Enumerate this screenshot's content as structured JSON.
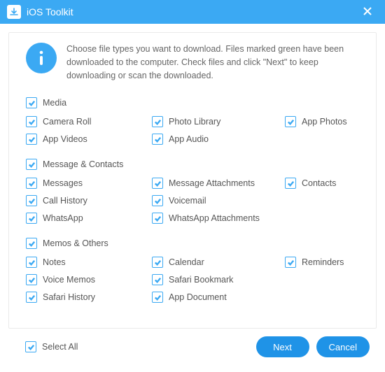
{
  "app": {
    "title": "iOS Toolkit"
  },
  "info": {
    "text": "Choose file types you want to download. Files marked green have been downloaded to the computer. Check files and click \"Next\" to keep downloading or scan the downloaded."
  },
  "groups": [
    {
      "header": "Media",
      "items": [
        {
          "label": "Camera Roll",
          "checked": true
        },
        {
          "label": "Photo Library",
          "checked": true
        },
        {
          "label": "App Photos",
          "checked": true
        },
        {
          "label": "App Videos",
          "checked": true
        },
        {
          "label": "App Audio",
          "checked": true
        }
      ]
    },
    {
      "header": "Message & Contacts",
      "items": [
        {
          "label": "Messages",
          "checked": true
        },
        {
          "label": "Message Attachments",
          "checked": true
        },
        {
          "label": "Contacts",
          "checked": true
        },
        {
          "label": "Call History",
          "checked": true
        },
        {
          "label": "Voicemail",
          "checked": true
        },
        {
          "label": "",
          "checked": null
        },
        {
          "label": "WhatsApp",
          "checked": true
        },
        {
          "label": "WhatsApp Attachments",
          "checked": true
        }
      ]
    },
    {
      "header": "Memos & Others",
      "items": [
        {
          "label": "Notes",
          "checked": true
        },
        {
          "label": "Calendar",
          "checked": true
        },
        {
          "label": "Reminders",
          "checked": true
        },
        {
          "label": "Voice Memos",
          "checked": true
        },
        {
          "label": "Safari Bookmark",
          "checked": true
        },
        {
          "label": "",
          "checked": null
        },
        {
          "label": "Safari History",
          "checked": true
        },
        {
          "label": "App Document",
          "checked": true
        }
      ]
    }
  ],
  "footer": {
    "select_all": "Select All",
    "select_all_checked": true,
    "next": "Next",
    "cancel": "Cancel"
  },
  "colors": {
    "accent": "#3ba9f3",
    "button": "#1f93e7"
  }
}
